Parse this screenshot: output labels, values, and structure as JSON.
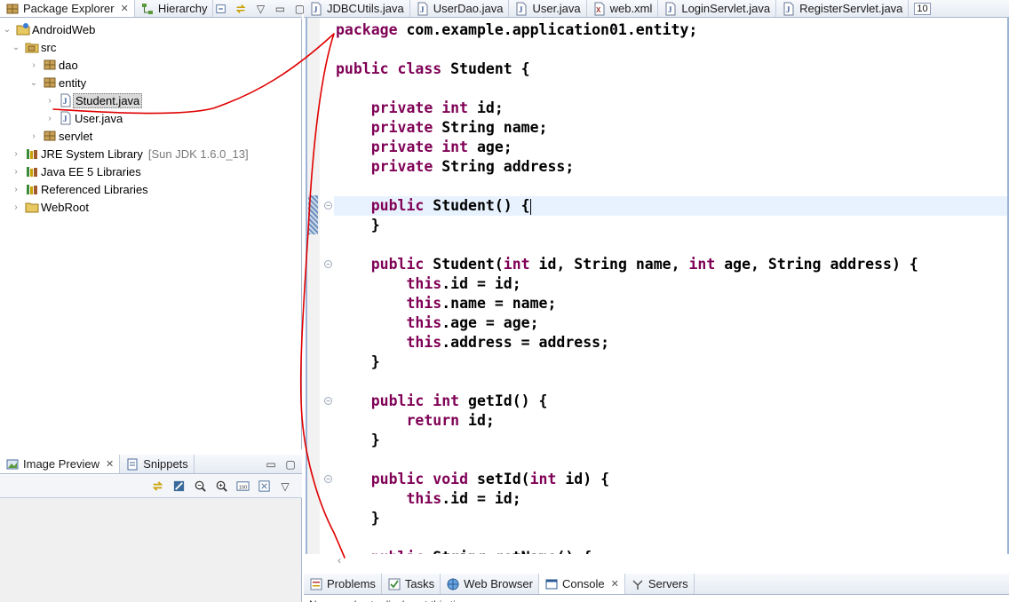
{
  "package_explorer": {
    "tabs": [
      {
        "label": "Package Explorer",
        "closable": true,
        "active": true,
        "icon": "package-icon"
      },
      {
        "label": "Hierarchy",
        "closable": false,
        "active": false,
        "icon": "hierarchy-icon"
      }
    ],
    "tree": [
      {
        "label": "AndroidWeb",
        "depth": 0,
        "expanded": true,
        "icon": "project-icon"
      },
      {
        "label": "src",
        "depth": 1,
        "expanded": true,
        "icon": "source-folder-icon"
      },
      {
        "label": "dao",
        "depth": 2,
        "expanded": false,
        "icon": "package-icon"
      },
      {
        "label": "entity",
        "depth": 2,
        "expanded": true,
        "icon": "package-icon"
      },
      {
        "label": "Student.java",
        "depth": 3,
        "expanded": false,
        "icon": "java-file-icon",
        "selected": true
      },
      {
        "label": "User.java",
        "depth": 3,
        "expanded": false,
        "icon": "java-file-icon"
      },
      {
        "label": "servlet",
        "depth": 2,
        "expanded": false,
        "icon": "package-icon"
      },
      {
        "label": "JRE System Library",
        "decoration": "[Sun JDK 1.6.0_13]",
        "depth": 0,
        "expanded": false,
        "icon": "library-icon"
      },
      {
        "label": "Java EE 5 Libraries",
        "depth": 0,
        "expanded": false,
        "icon": "library-icon"
      },
      {
        "label": "Referenced Libraries",
        "depth": 0,
        "expanded": false,
        "icon": "library-icon"
      },
      {
        "label": "WebRoot",
        "depth": 0,
        "expanded": false,
        "icon": "folder-icon"
      }
    ]
  },
  "image_preview": {
    "tabs": [
      {
        "label": "Image Preview",
        "closable": true,
        "active": true
      },
      {
        "label": "Snippets",
        "closable": false,
        "active": false
      }
    ]
  },
  "editor": {
    "tabs": [
      {
        "label": "JDBCUtils.java",
        "icon": "java-file-icon"
      },
      {
        "label": "UserDao.java",
        "icon": "java-file-icon"
      },
      {
        "label": "User.java",
        "icon": "java-file-icon"
      },
      {
        "label": "web.xml",
        "icon": "xml-file-icon"
      },
      {
        "label": "LoginServlet.java",
        "icon": "java-file-icon"
      },
      {
        "label": "RegisterServlet.java",
        "icon": "java-file-icon"
      }
    ],
    "overflow_count": "10",
    "code_lines": [
      "package com.example.application01.entity;",
      "",
      "public class Student {",
      "",
      "    private int id;",
      "    private String name;",
      "    private int age;",
      "    private String address;",
      "",
      "    public Student() {",
      "    }",
      "",
      "    public Student(int id, String name, int age, String address) {",
      "        this.id = id;",
      "        this.name = name;",
      "        this.age = age;",
      "        this.address = address;",
      "    }",
      "",
      "    public int getId() {",
      "        return id;",
      "    }",
      "",
      "    public void setId(int id) {",
      "        this.id = id;",
      "    }",
      "",
      "    public String getName() {"
    ],
    "keywords": [
      "package",
      "public",
      "class",
      "private",
      "int",
      "this",
      "return",
      "void"
    ],
    "current_line": 10,
    "fold_lines": [
      10,
      13,
      20,
      24
    ],
    "keyword_color": "#7f0055",
    "current_line_color": "#e8f2fe"
  },
  "bottom_views": {
    "tabs": [
      {
        "label": "Problems",
        "icon": "problems-icon",
        "active": false
      },
      {
        "label": "Tasks",
        "icon": "tasks-icon",
        "active": false
      },
      {
        "label": "Web Browser",
        "icon": "globe-icon",
        "active": false
      },
      {
        "label": "Console",
        "icon": "console-icon",
        "active": true,
        "closable": true
      },
      {
        "label": "Servers",
        "icon": "servers-icon",
        "active": false
      }
    ],
    "console_text": "No consoles to display at this time."
  },
  "annotation_color": "#e00000"
}
